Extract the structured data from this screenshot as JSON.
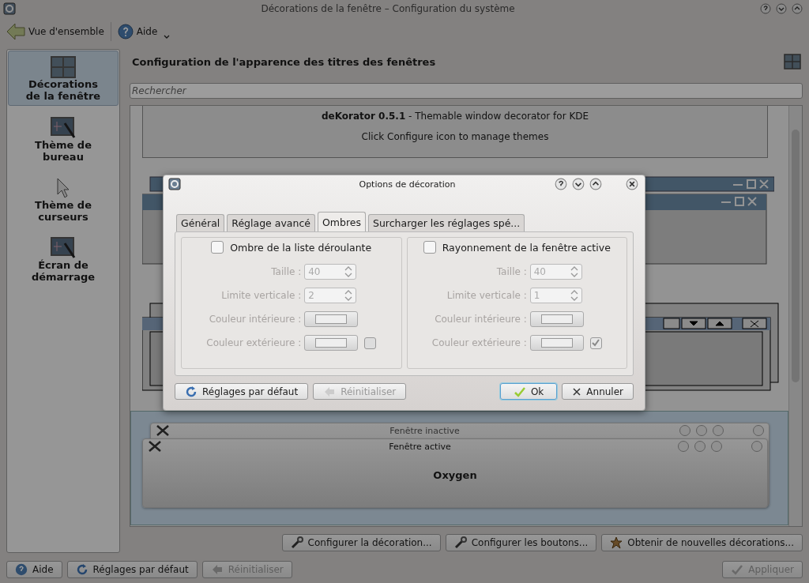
{
  "window": {
    "title": "Décorations de la fenêtre – Configuration du système"
  },
  "toolbar": [
    {
      "kind": "back",
      "label": "Vue d'ensemble"
    },
    {
      "kind": "help",
      "label": "Aide"
    }
  ],
  "sidebar": {
    "items": [
      {
        "kind": "windows",
        "label": "Décorations de la fenêtre",
        "selected": true
      },
      {
        "kind": "desktop",
        "label": "Thème de bureau",
        "selected": false
      },
      {
        "kind": "cursor",
        "label": "Thème de curseurs",
        "selected": false
      },
      {
        "kind": "splash",
        "label": "Écran de démarrage",
        "selected": false
      }
    ]
  },
  "heading": "Configuration de l'apparence des titres des fenêtres",
  "search": {
    "placeholder": "Rechercher"
  },
  "decorations": [
    {
      "kind": "text",
      "title": "**deKorator 0.5.1** - Themable window decorator for KDE",
      "note": "Click Configure icon to manage themes",
      "selected": false
    },
    {
      "kind": "flat",
      "selected": false
    },
    {
      "kind": "classic",
      "selected": false
    },
    {
      "kind": "oxygen",
      "inactive_title": "Fenêtre inactive",
      "active_title": "Fenêtre active",
      "name": "Oxygen",
      "selected": true
    }
  ],
  "actions": [
    {
      "kind": "tool",
      "label": "Configurer la décoration..."
    },
    {
      "kind": "tool",
      "label": "Configurer les boutons..."
    },
    {
      "kind": "star",
      "label": "Obtenir de nouvelles décorations..."
    }
  ],
  "footer": {
    "left": [
      {
        "kind": "help",
        "label": "Aide",
        "disabled": false
      },
      {
        "kind": "defaults",
        "label": "Réglages par défaut",
        "disabled": false
      },
      {
        "kind": "reset",
        "label": "Réinitialiser",
        "disabled": true
      }
    ],
    "right": [
      {
        "kind": "apply",
        "label": "Appliquer",
        "disabled": true
      }
    ]
  },
  "dialog": {
    "title": "Options de décoration",
    "tabs": [
      {
        "label": "Général",
        "selected": false
      },
      {
        "label": "Réglage avancé",
        "selected": false
      },
      {
        "label": "Ombres",
        "selected": true
      },
      {
        "label": "Surcharger les réglages spé...",
        "selected": false
      }
    ],
    "groups": [
      {
        "title": "Ombre de la liste déroulante",
        "checked": false,
        "fields": [
          {
            "kind": "spin",
            "label": "Taille :",
            "value": "40"
          },
          {
            "kind": "spin",
            "label": "Limite verticale :",
            "value": "2"
          },
          {
            "kind": "color",
            "label": "Couleur intérieure :"
          },
          {
            "kind": "color",
            "label": "Couleur extérieure :",
            "checked": false
          }
        ]
      },
      {
        "title": "Rayonnement de la fenêtre active",
        "checked": false,
        "fields": [
          {
            "kind": "spin",
            "label": "Taille :",
            "value": "40"
          },
          {
            "kind": "spin",
            "label": "Limite verticale :",
            "value": "1"
          },
          {
            "kind": "color",
            "label": "Couleur intérieure :"
          },
          {
            "kind": "color",
            "label": "Couleur extérieure :",
            "checked": true
          }
        ]
      }
    ],
    "left_buttons": [
      {
        "kind": "defaults",
        "label": "Réglages par défaut",
        "disabled": false,
        "default": false
      },
      {
        "kind": "reset",
        "label": "Réinitialiser",
        "disabled": true,
        "default": false
      }
    ],
    "right_buttons": [
      {
        "kind": "ok",
        "label": "Ok",
        "disabled": false,
        "default": true
      },
      {
        "kind": "cancel",
        "label": "Annuler",
        "disabled": false,
        "default": false
      }
    ]
  }
}
